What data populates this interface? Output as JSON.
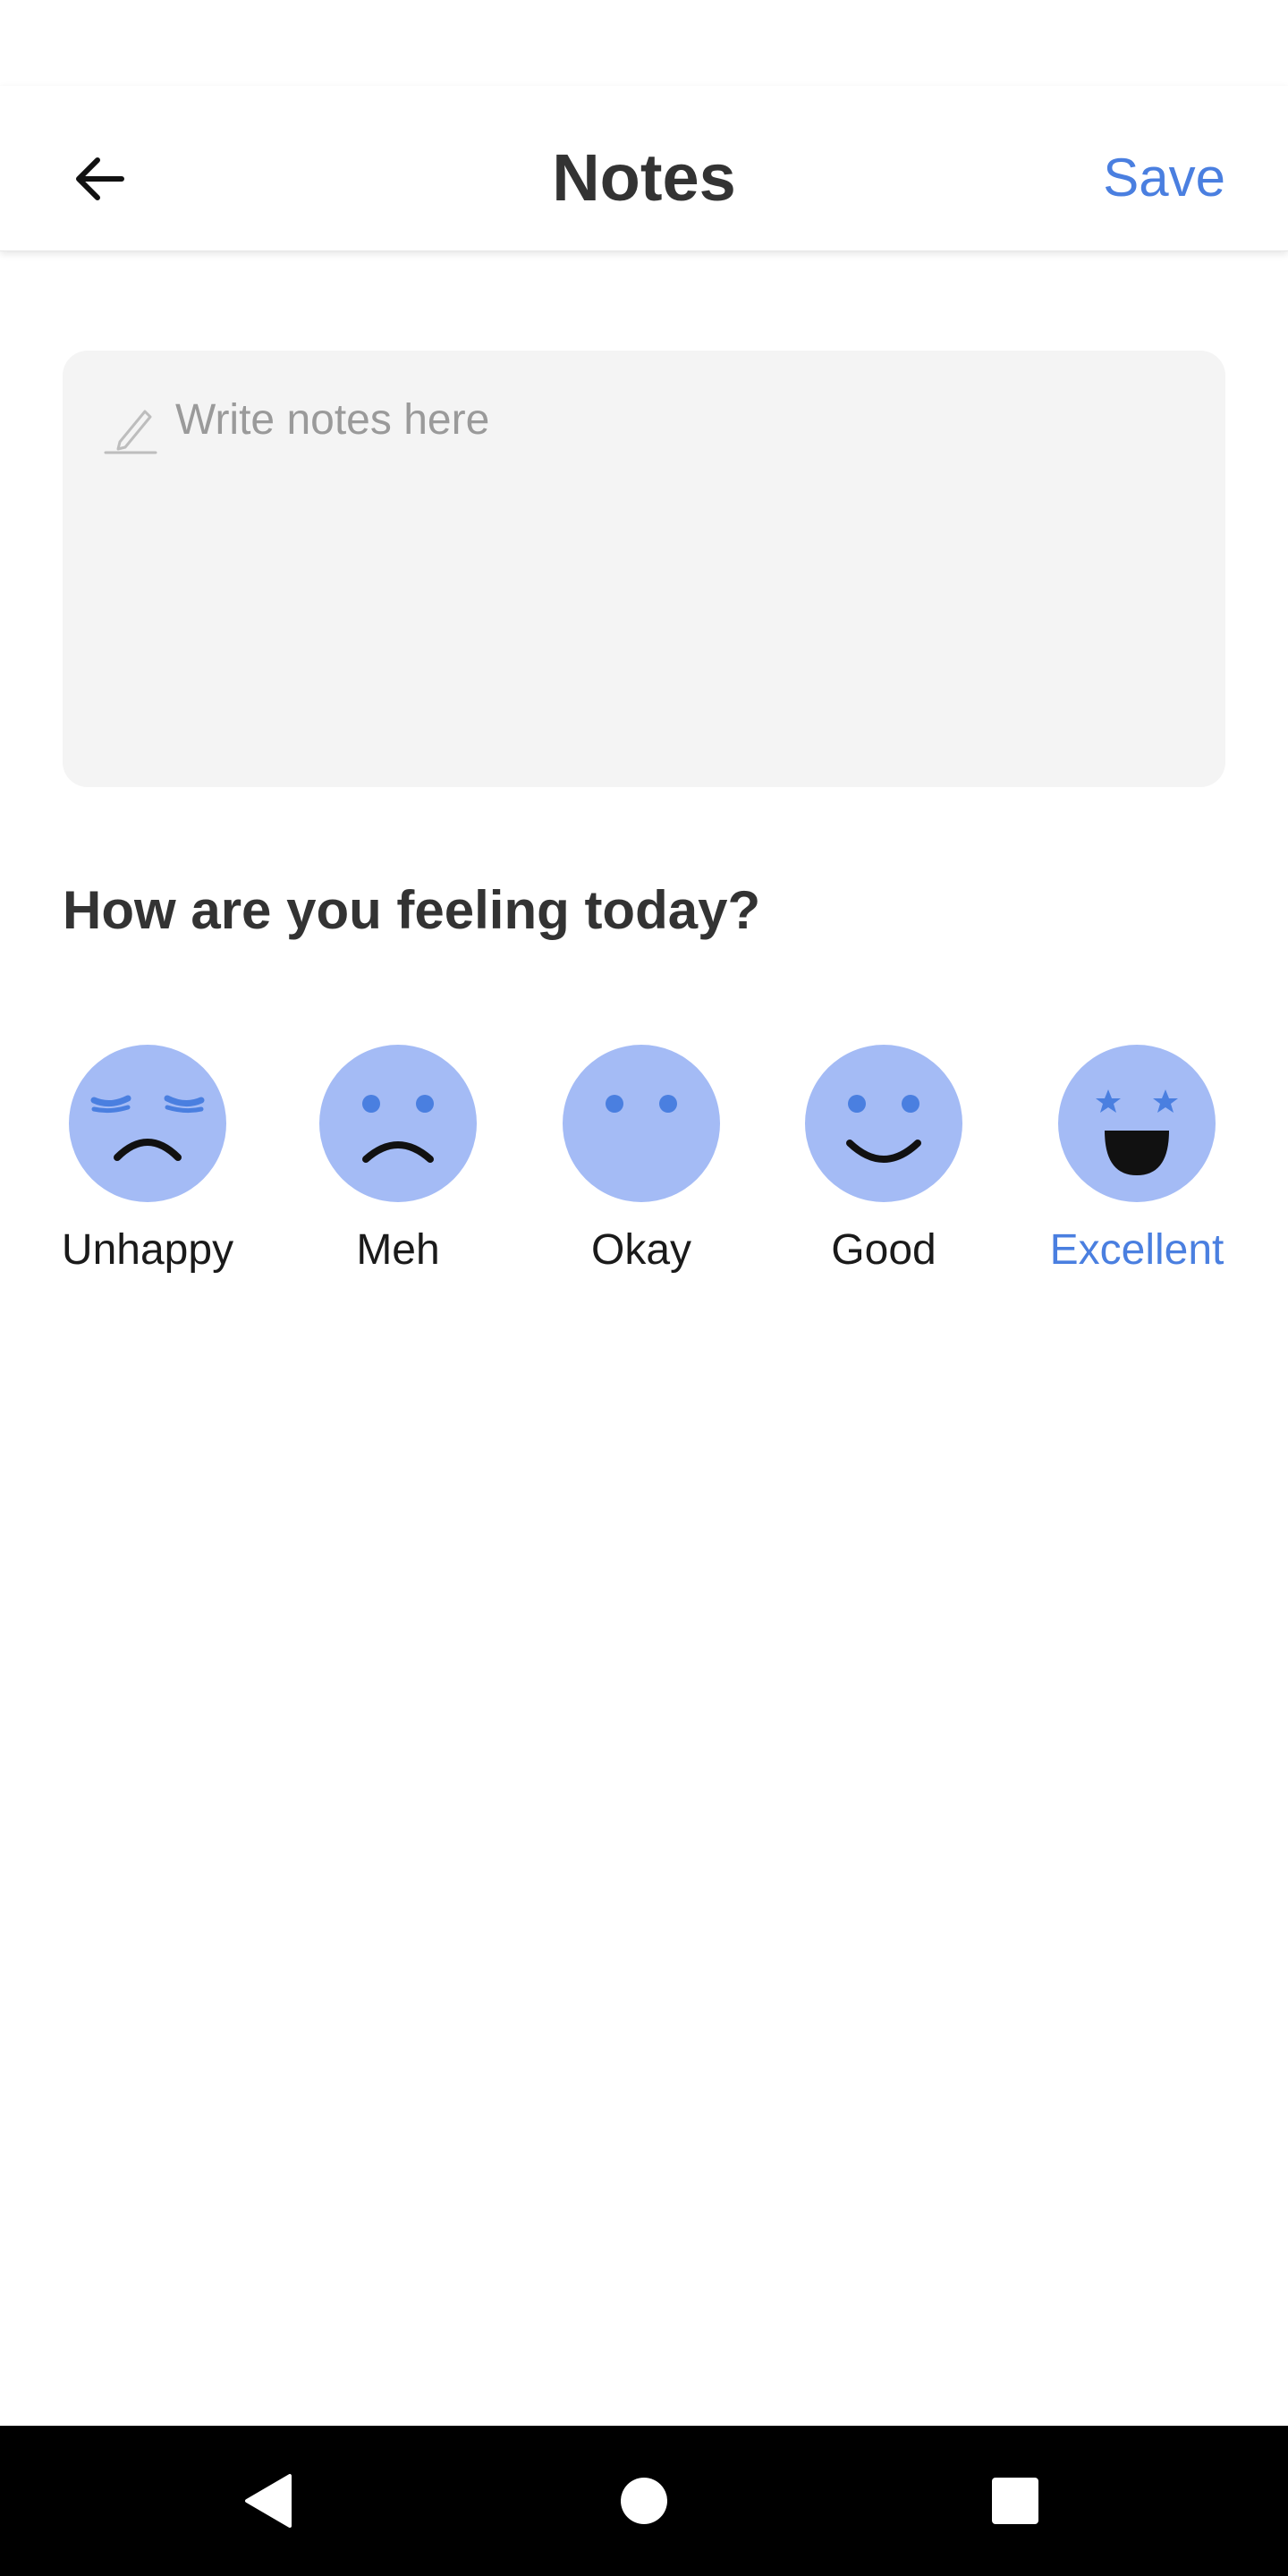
{
  "header": {
    "title": "Notes",
    "save_label": "Save",
    "back_icon": "arrow-left-icon"
  },
  "notes": {
    "placeholder": "Write notes here",
    "value": "",
    "icon": "pencil-icon"
  },
  "mood": {
    "question": "How are you feeling today?",
    "selected": "Excellent",
    "options": [
      {
        "label": "Unhappy",
        "icon": "unhappy-face-icon"
      },
      {
        "label": "Meh",
        "icon": "meh-face-icon"
      },
      {
        "label": "Okay",
        "icon": "okay-face-icon"
      },
      {
        "label": "Good",
        "icon": "good-face-icon"
      },
      {
        "label": "Excellent",
        "icon": "excellent-face-icon"
      }
    ]
  },
  "colors": {
    "accent": "#4a7fe0",
    "face_fill": "#a4bbf5",
    "face_feature_blue": "#4a7fe0",
    "title_text": "#333333",
    "notes_background": "#f4f4f4",
    "nav_bar": "#000000"
  },
  "system_nav": {
    "back_icon": "nav-back-triangle-icon",
    "home_icon": "nav-home-circle-icon",
    "recents_icon": "nav-recents-square-icon"
  }
}
